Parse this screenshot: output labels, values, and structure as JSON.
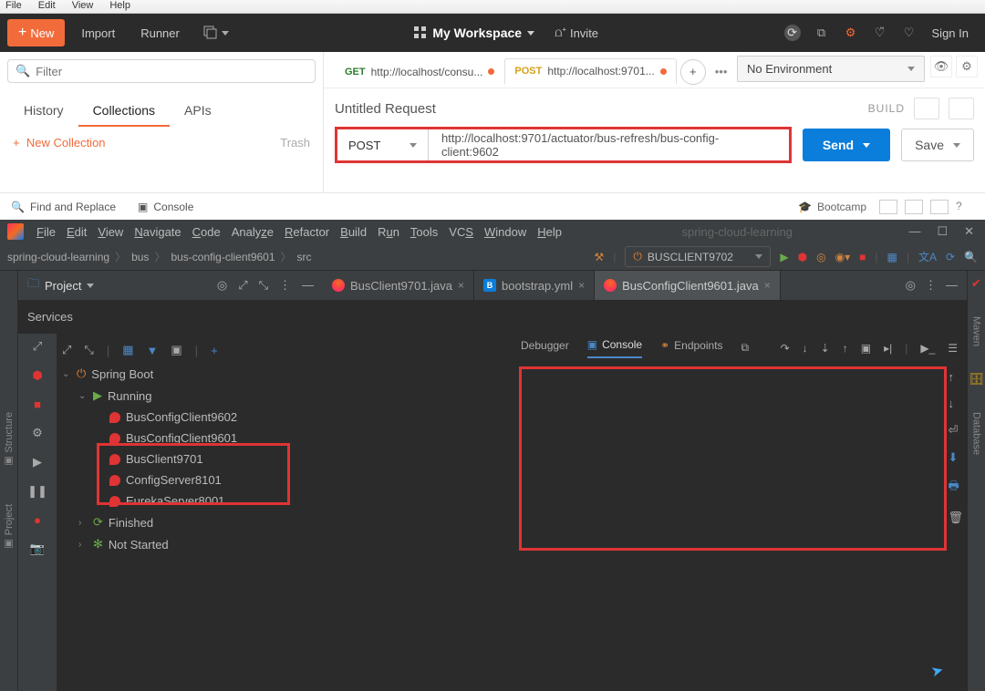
{
  "postman": {
    "menubar": [
      "File",
      "Edit",
      "View",
      "Help"
    ],
    "toolbar": {
      "new": "New",
      "import": "Import",
      "runner": "Runner",
      "workspace": "My Workspace",
      "invite": "Invite",
      "signin": "Sign In"
    },
    "sidebar": {
      "filter_placeholder": "Filter",
      "tabs": {
        "history": "History",
        "collections": "Collections",
        "apis": "APIs"
      },
      "new_collection": "New Collection",
      "trash": "Trash"
    },
    "request_tabs": [
      {
        "method": "GET",
        "label": "http://localhost/consu..."
      },
      {
        "method": "POST",
        "label": "http://localhost:9701..."
      }
    ],
    "environment": "No Environment",
    "request_title": "Untitled Request",
    "build": "BUILD",
    "method": "POST",
    "url": "http://localhost:9701/actuator/bus-refresh/bus-config-client:9602",
    "send": "Send",
    "save": "Save",
    "statusbar": {
      "find": "Find and Replace",
      "console": "Console",
      "bootcamp": "Bootcamp"
    }
  },
  "intellij": {
    "menubar": [
      "File",
      "Edit",
      "View",
      "Navigate",
      "Code",
      "Analyze",
      "Refactor",
      "Build",
      "Run",
      "Tools",
      "VCS",
      "Window",
      "Help"
    ],
    "project_name": "spring-cloud-learning",
    "breadcrumb": [
      "spring-cloud-learning",
      "bus",
      "bus-config-client9601",
      "src"
    ],
    "run_config": "BUSCLIENT9702",
    "project_label": "Project",
    "editor_tabs": [
      {
        "name": "BusClient9701.java",
        "type": "java"
      },
      {
        "name": "bootstrap.yml",
        "type": "yml"
      },
      {
        "name": "BusConfigClient9601.java",
        "type": "java",
        "active": true
      }
    ],
    "services_label": "Services",
    "left_gutter_labels": [
      "Structure",
      "Project"
    ],
    "right_gutter_labels": [
      "Maven",
      "Database"
    ],
    "tree": {
      "springboot": "Spring Boot",
      "running": "Running",
      "apps": [
        "BusConfigClient9602",
        "BusConfigClient9601",
        "BusClient9701",
        "ConfigServer8101",
        "EurekaServer8001"
      ],
      "finished": "Finished",
      "notstarted": "Not Started"
    },
    "debug_tabs": {
      "debugger": "Debugger",
      "console": "Console",
      "endpoints": "Endpoints"
    }
  }
}
